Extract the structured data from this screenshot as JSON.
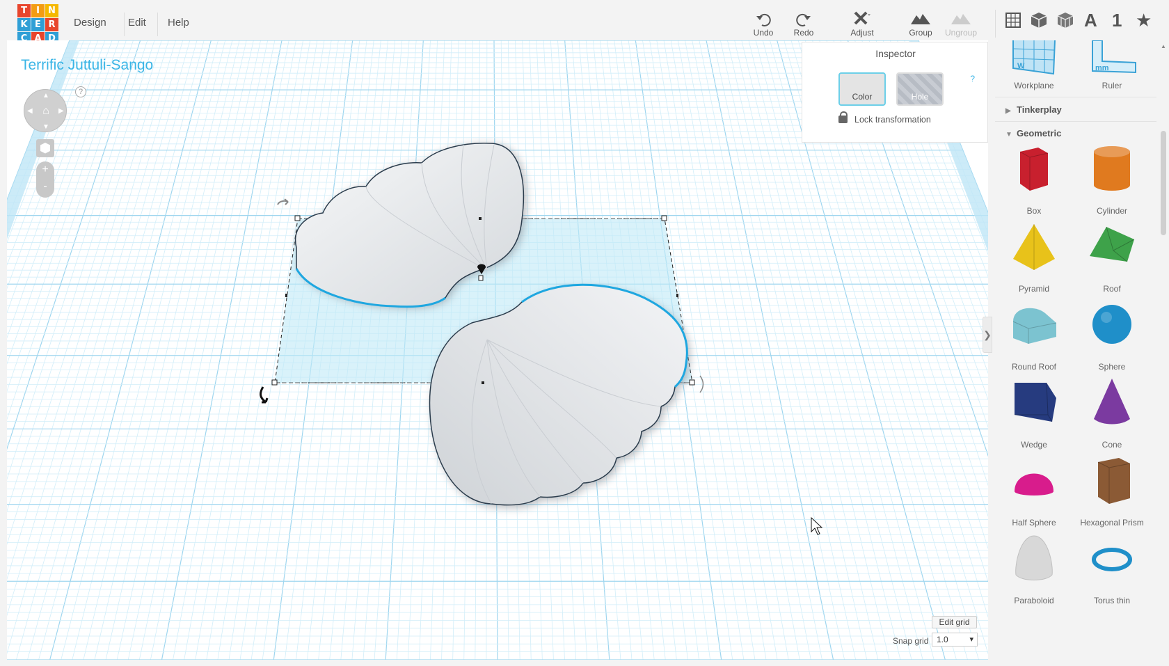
{
  "app": {
    "logo_letters": [
      "T",
      "I",
      "N",
      "K",
      "E",
      "R",
      "C",
      "A",
      "D"
    ],
    "logo_colors": [
      "#e8452c",
      "#f39c12",
      "#f5b800",
      "#2f9fd6",
      "#2f9fd6",
      "#e8452c",
      "#2f9fd6",
      "#e8452c",
      "#2f9fd6"
    ],
    "menu": [
      "Design",
      "Edit",
      "Help"
    ],
    "toolbar": {
      "undo": "Undo",
      "redo": "Redo",
      "adjust": "Adjust",
      "group": "Group",
      "ungroup": "Ungroup"
    },
    "view_icons": [
      "workplane-view-icon",
      "box-view-icon",
      "wireframe-view-icon",
      "text-icon",
      "number-icon",
      "star-icon"
    ],
    "view_labels": {
      "text": "A",
      "number": "1",
      "star": "★"
    }
  },
  "canvas": {
    "design_title": "Terrific Juttuli-Sango",
    "nav_help": "?",
    "zoom_in": "+",
    "zoom_out": "-"
  },
  "inspector": {
    "title": "Inspector",
    "help": "?",
    "color_label": "Color",
    "hole_label": "Hole",
    "lock_label": "Lock transformation"
  },
  "grid": {
    "edit_grid": "Edit grid",
    "snap_label": "Snap grid",
    "snap_value": "1.0"
  },
  "panel": {
    "top_items": [
      {
        "label": "Workplane",
        "icon": "workplane-icon"
      },
      {
        "label": "Ruler",
        "icon": "ruler-icon"
      }
    ],
    "sections": [
      {
        "label": "Tinkerplay",
        "expanded": false
      },
      {
        "label": "Geometric",
        "expanded": true
      }
    ],
    "shapes": [
      {
        "label": "Box",
        "color": "#c8202e"
      },
      {
        "label": "Cylinder",
        "color": "#e07a1f"
      },
      {
        "label": "Pyramid",
        "color": "#e8c21a"
      },
      {
        "label": "Roof",
        "color": "#3ea24a"
      },
      {
        "label": "Round Roof",
        "color": "#7cc3d0"
      },
      {
        "label": "Sphere",
        "color": "#1f8fc9"
      },
      {
        "label": "Wedge",
        "color": "#263b7f"
      },
      {
        "label": "Cone",
        "color": "#7b3aa0"
      },
      {
        "label": "Half Sphere",
        "color": "#d81c8c"
      },
      {
        "label": "Hexagonal Prism",
        "color": "#8b5a35"
      },
      {
        "label": "Paraboloid",
        "color": "#d8d8d8"
      },
      {
        "label": "Torus thin",
        "color": "#1f8fc9"
      }
    ]
  }
}
